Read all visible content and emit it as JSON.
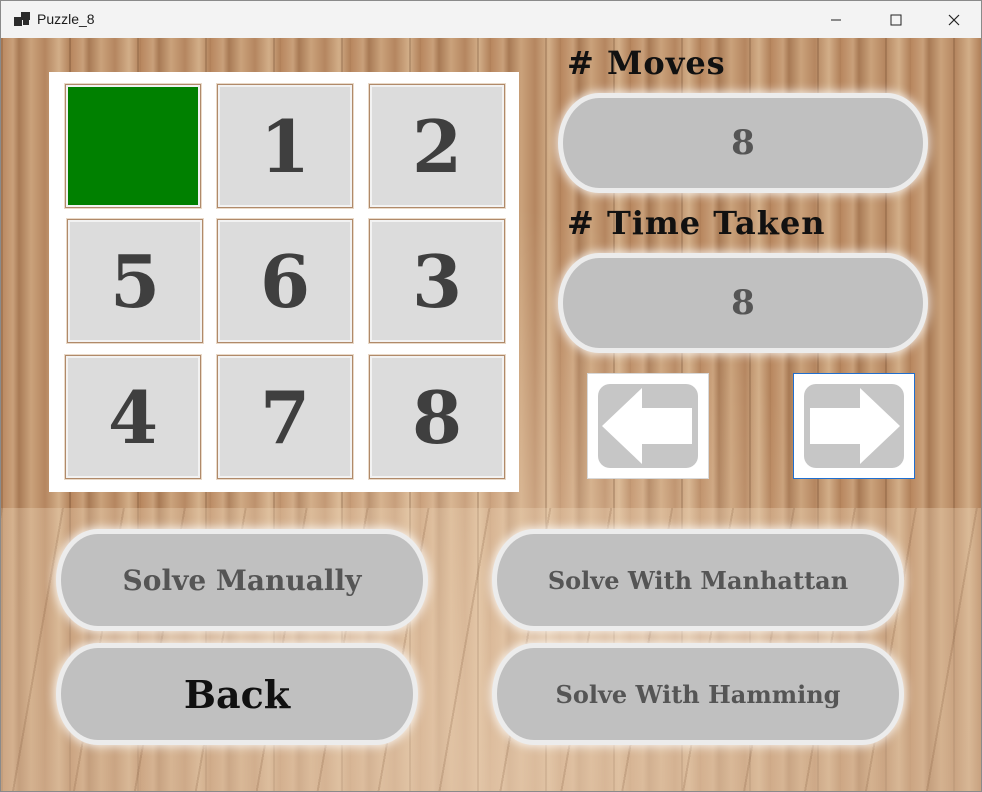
{
  "window": {
    "title": "Puzzle_8",
    "app_icon": "window-stack-icon"
  },
  "board": {
    "tiles": [
      "",
      "1",
      "2",
      "5",
      "6",
      "3",
      "4",
      "7",
      "8"
    ],
    "empty_color": "#008000"
  },
  "stats": {
    "moves_label": "# Moves",
    "moves_value": "8",
    "time_label": "# Time Taken",
    "time_value": "8"
  },
  "nav": {
    "prev_icon": "arrow-left-icon",
    "next_icon": "arrow-right-icon"
  },
  "actions": {
    "solve_manually": "Solve Manually",
    "solve_manhattan": "Solve With Manhattan",
    "back": "Back",
    "solve_hamming": "Solve With Hamming"
  },
  "colors": {
    "tile_bg": "#dcdcdc",
    "pill_bg": "#c0c0c0",
    "focus_border": "#1f6fd0"
  }
}
